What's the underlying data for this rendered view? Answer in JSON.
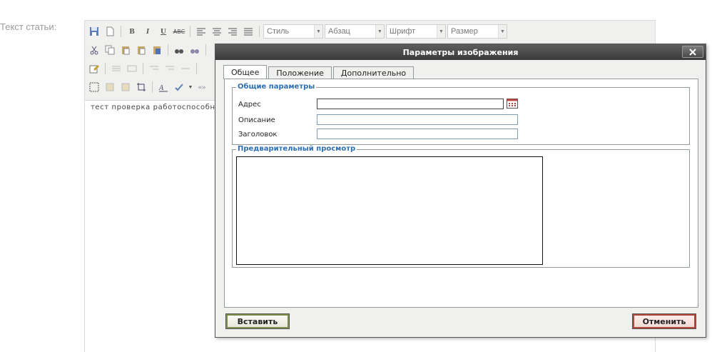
{
  "page": {
    "label": "Текст статьи:"
  },
  "editor": {
    "toolbar": {
      "style_select": "Стиль",
      "format_select": "Абзац",
      "font_select": "Шрифт",
      "size_select": "Размер",
      "bold": "B",
      "italic": "I",
      "underline": "U",
      "strike": "ABC"
    },
    "content": "тест проверка работоспособно"
  },
  "dialog": {
    "title": "Параметры изображения",
    "tabs": [
      "Общее",
      "Положение",
      "Дополнительно"
    ],
    "general": {
      "legend": "Общие параметры",
      "address_label": "Адрес",
      "address_value": "",
      "description_label": "Описание",
      "description_value": "",
      "title_label": "Заголовок",
      "title_value": ""
    },
    "preview": {
      "legend": "Предварительный просмотр"
    },
    "buttons": {
      "insert": "Вставить",
      "cancel": "Отменить"
    }
  },
  "colors": {
    "legend": "#2b6fb6",
    "titlebar": "#4a4a4a",
    "insert_border": "#7c8f4f",
    "cancel_border": "#b5483a"
  }
}
